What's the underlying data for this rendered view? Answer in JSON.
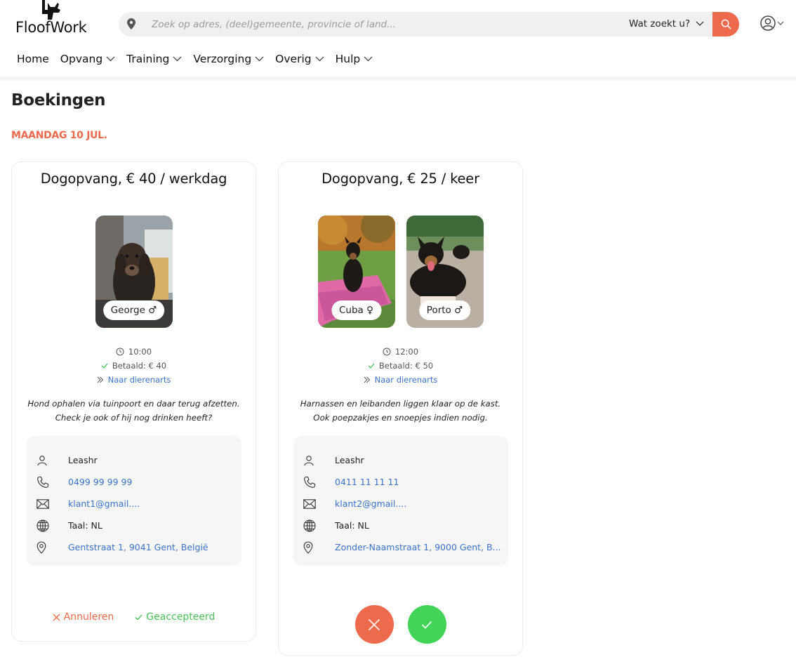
{
  "brand": {
    "name": "FloofWork"
  },
  "search": {
    "placeholder": "Zoek op adres, (deel)gemeente, provincie of land...",
    "category_label": "Wat zoekt u?",
    "icons": {
      "location": "map-pin-icon",
      "submit": "search-icon",
      "dropdown": "chevron-down-icon"
    }
  },
  "user_menu": {
    "icon": "user-circle-icon"
  },
  "nav": [
    {
      "label": "Home",
      "dropdown": false
    },
    {
      "label": "Opvang",
      "dropdown": true
    },
    {
      "label": "Training",
      "dropdown": true
    },
    {
      "label": "Verzorging",
      "dropdown": true
    },
    {
      "label": "Overig",
      "dropdown": true
    },
    {
      "label": "Hulp",
      "dropdown": true
    }
  ],
  "page": {
    "title": "Boekingen",
    "date": "MAANDAG 10 JUL."
  },
  "colors": {
    "accent": "#ee6a4c",
    "success": "#42d456",
    "link": "#3b73c9",
    "panel": "#f6f6f6"
  },
  "bookings": [
    {
      "title": "Dogopvang, € 40 / werkdag",
      "pets": [
        {
          "name": "George",
          "sex": "♂"
        }
      ],
      "time": "10:00",
      "paid": "Betaald: € 40",
      "vet_link": "Naar dierenarts",
      "note_lines": [
        "Hond ophalen via tuinpoort en daar terug afzetten.",
        "Check je ook of hij nog drinken heeft?"
      ],
      "contact": {
        "name": "Leashr",
        "phone": "0499 99 99 99",
        "email": "klant1@gmail....",
        "language": "Taal: NL",
        "address": "Gentstraat 1, 9041 Gent, België"
      },
      "actions": {
        "cancel": "Annuleren",
        "status": "Geaccepteerd"
      }
    },
    {
      "title": "Dogopvang, € 25 / keer",
      "pets": [
        {
          "name": "Cuba",
          "sex": "♀"
        },
        {
          "name": "Porto",
          "sex": "♂"
        }
      ],
      "time": "12:00",
      "paid": "Betaald: € 50",
      "vet_link": "Naar dierenarts",
      "note_lines": [
        "Harnassen en leibanden liggen klaar op de kast.",
        "Ook poepzakjes en snoepjes indien nodig."
      ],
      "contact": {
        "name": "Leashr",
        "phone": "0411 11 11 11",
        "email": "klant2@gmail....",
        "language": "Taal: NL",
        "address": "Zonder-Naamstraat 1, 9000 Gent, B..."
      },
      "actions": {
        "decline_icon": "close-icon",
        "accept_icon": "check-icon"
      }
    }
  ]
}
